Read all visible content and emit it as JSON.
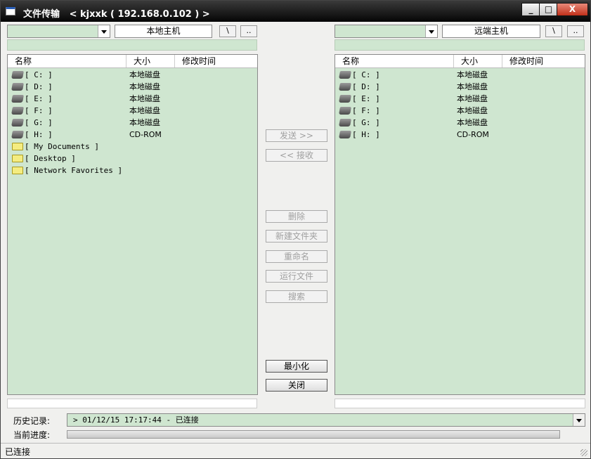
{
  "window": {
    "title": "文件传输",
    "subtitle": "< kjxxk ( 192.168.0.102 ) >",
    "min_label": "_",
    "max_label": "□",
    "close_label": "X"
  },
  "local": {
    "host_label": "本地主机",
    "root_btn": "\\",
    "up_btn": "..",
    "columns": [
      "名称",
      "大小",
      "修改时间"
    ],
    "rows": [
      {
        "name": "[ C: ]",
        "size": "本地磁盘",
        "icon": "drive-icon"
      },
      {
        "name": "[ D: ]",
        "size": "本地磁盘",
        "icon": "drive-icon"
      },
      {
        "name": "[ E: ]",
        "size": "本地磁盘",
        "icon": "drive-icon"
      },
      {
        "name": "[ F: ]",
        "size": "本地磁盘",
        "icon": "drive-icon"
      },
      {
        "name": "[ G: ]",
        "size": "本地磁盘",
        "icon": "drive-icon"
      },
      {
        "name": "[ H: ]",
        "size": "CD-ROM",
        "icon": "drive-icon"
      },
      {
        "name": "[ My Documents ]",
        "size": "",
        "icon": "folder-icon"
      },
      {
        "name": "[ Desktop ]",
        "size": "",
        "icon": "folder-icon"
      },
      {
        "name": "[ Network Favorites ]",
        "size": "",
        "icon": "folder-icon"
      }
    ]
  },
  "remote": {
    "host_label": "远端主机",
    "root_btn": "\\",
    "up_btn": "..",
    "columns": [
      "名称",
      "大小",
      "修改时间"
    ],
    "rows": [
      {
        "name": "[ C: ]",
        "size": "本地磁盘",
        "icon": "drive-icon"
      },
      {
        "name": "[ D: ]",
        "size": "本地磁盘",
        "icon": "drive-icon"
      },
      {
        "name": "[ E: ]",
        "size": "本地磁盘",
        "icon": "drive-icon"
      },
      {
        "name": "[ F: ]",
        "size": "本地磁盘",
        "icon": "drive-icon"
      },
      {
        "name": "[ G: ]",
        "size": "本地磁盘",
        "icon": "drive-icon"
      },
      {
        "name": "[ H: ]",
        "size": "CD-ROM",
        "icon": "drive-icon"
      }
    ]
  },
  "actions": {
    "send": "发送 >>",
    "receive": "<< 接收",
    "delete": "删除",
    "new_folder": "新建文件夹",
    "rename": "重命名",
    "run_file": "运行文件",
    "search": "搜索",
    "minimize": "最小化",
    "close": "关闭"
  },
  "footer": {
    "history_label": "历史记录:",
    "history_value": "> 01/12/15 17:17:44 - 已连接",
    "progress_label": "当前进度:",
    "progress": 0
  },
  "status": {
    "text": "已连接"
  }
}
